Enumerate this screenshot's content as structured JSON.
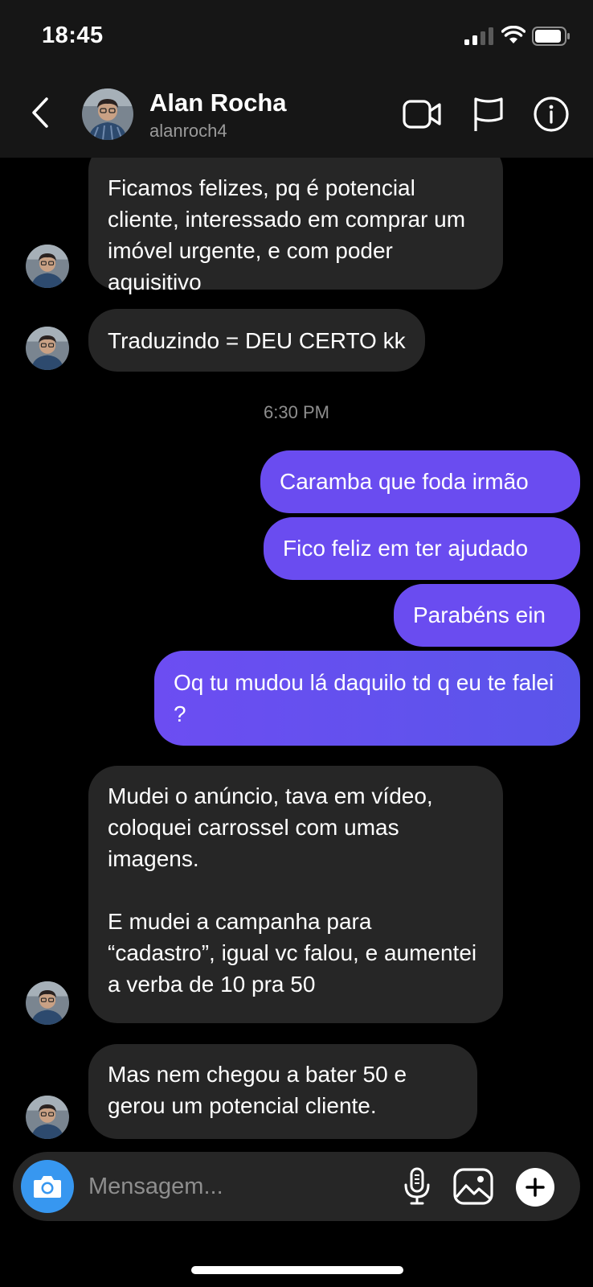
{
  "status_bar": {
    "time": "18:45"
  },
  "header": {
    "name": "Alan Rocha",
    "username": "alanroch4"
  },
  "messages": {
    "m1": "Ficamos felizes, pq é potencial cliente, interessado em comprar um imóvel urgente, e com poder aquisitivo",
    "m2": "Traduzindo = DEU CERTO kk",
    "timestamp": "6:30 PM",
    "m3": "Caramba que foda irmão",
    "m4": "Fico feliz em ter ajudado",
    "m5": "Parabéns ein",
    "m6": "Oq tu mudou lá daquilo td q eu te falei ?",
    "m7a": "Mudei o anúncio, tava em vídeo, coloquei carrossel com umas imagens.",
    "m7b": "E mudei a campanha para “cadastro”, igual vc falou, e aumentei a verba de 10 pra 50",
    "m8": "Mas nem chegou a bater 50 e gerou um potencial cliente."
  },
  "composer": {
    "placeholder": "Mensagem..."
  },
  "colors": {
    "outgoing_bubble": "#6a4cf0",
    "incoming_bubble": "#262626",
    "camera_button": "#3797f0"
  },
  "icons": [
    "back-icon",
    "video-call-icon",
    "flag-icon",
    "info-icon",
    "camera-icon",
    "microphone-icon",
    "gallery-icon",
    "plus-icon"
  ]
}
